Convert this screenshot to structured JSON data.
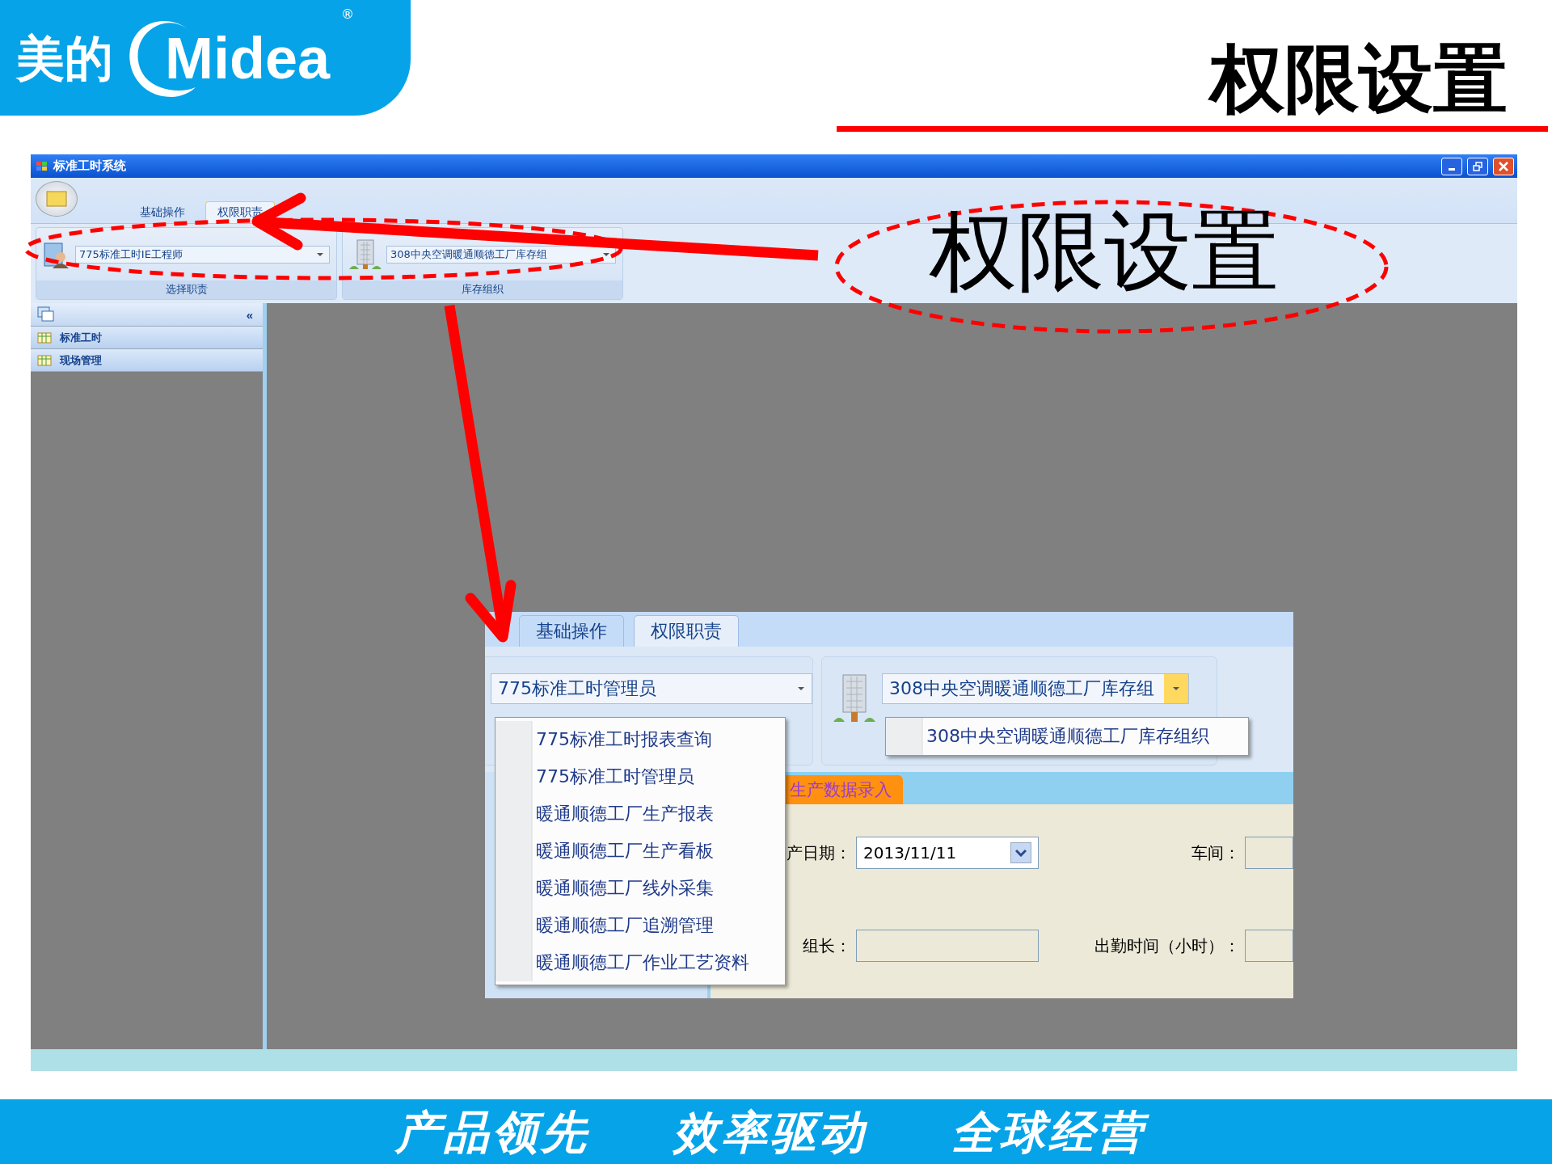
{
  "header": {
    "brand_text": "美的",
    "wordmark": "Midea",
    "registered_mark": "®",
    "title": "权限设置"
  },
  "window": {
    "title": "标准工时系统",
    "tabs": [
      {
        "label": "基础操作",
        "selected": false
      },
      {
        "label": "权限职责",
        "selected": true
      }
    ],
    "groups": [
      {
        "kind": "role",
        "value": "775标准工时IE工程师",
        "label": "选择职责"
      },
      {
        "kind": "org",
        "value": "308中央空调暖通顺德工厂库存组",
        "label": "库存组织"
      }
    ],
    "sidebar": {
      "collapse_glyph": "«",
      "items": [
        {
          "label": "标准工时"
        },
        {
          "label": "现场管理"
        }
      ]
    }
  },
  "inset": {
    "tabs": [
      {
        "label": "基础操作",
        "selected": false
      },
      {
        "label": "权限职责",
        "selected": true
      }
    ],
    "role_value": "775标准工时管理员",
    "role_options": [
      "775标准工时报表查询",
      "775标准工时管理员",
      "暖通顺德工厂生产报表",
      "暖通顺德工厂生产看板",
      "暖通顺德工厂线外采集",
      "暖通顺德工厂追溯管理",
      "暖通顺德工厂作业工艺资料"
    ],
    "org_value": "308中央空调暖通顺德工厂库存组",
    "org_options": [
      "308中央空调暖通顺德工厂库存组织"
    ],
    "doc_tab": "生产数据录入",
    "fields": [
      {
        "kind": "date",
        "label": "产日期：",
        "value": "2013/11/11"
      },
      {
        "kind": "text",
        "label": "车间："
      },
      {
        "kind": "text",
        "label": "组长："
      },
      {
        "kind": "text",
        "label": "出勤时间（小时）："
      }
    ]
  },
  "annotation": {
    "label": "权限设置"
  },
  "footer": {
    "slogans": [
      "产品领先",
      "效率驱动",
      "全球经营"
    ]
  }
}
